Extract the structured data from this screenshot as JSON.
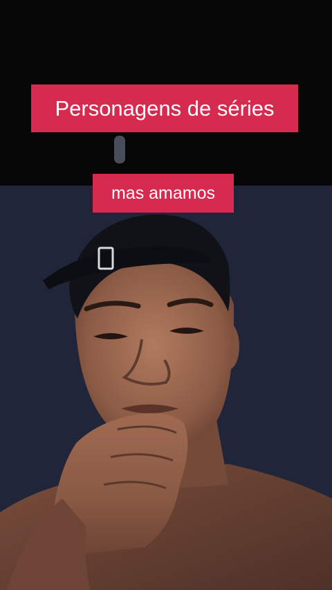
{
  "captions": {
    "top": "Personagens de séries",
    "bottom": "mas amamos"
  },
  "colors": {
    "caption_background": "#d62a4e",
    "caption_text": "#ffffff",
    "backdrop_top": "#070708",
    "backdrop_wall": "#22263a",
    "skin": "#8a5a44"
  },
  "scene": {
    "subject": "person-wearing-backwards-cap",
    "icons": [
      "backwards-cap-icon",
      "hand-on-chin-icon"
    ]
  }
}
